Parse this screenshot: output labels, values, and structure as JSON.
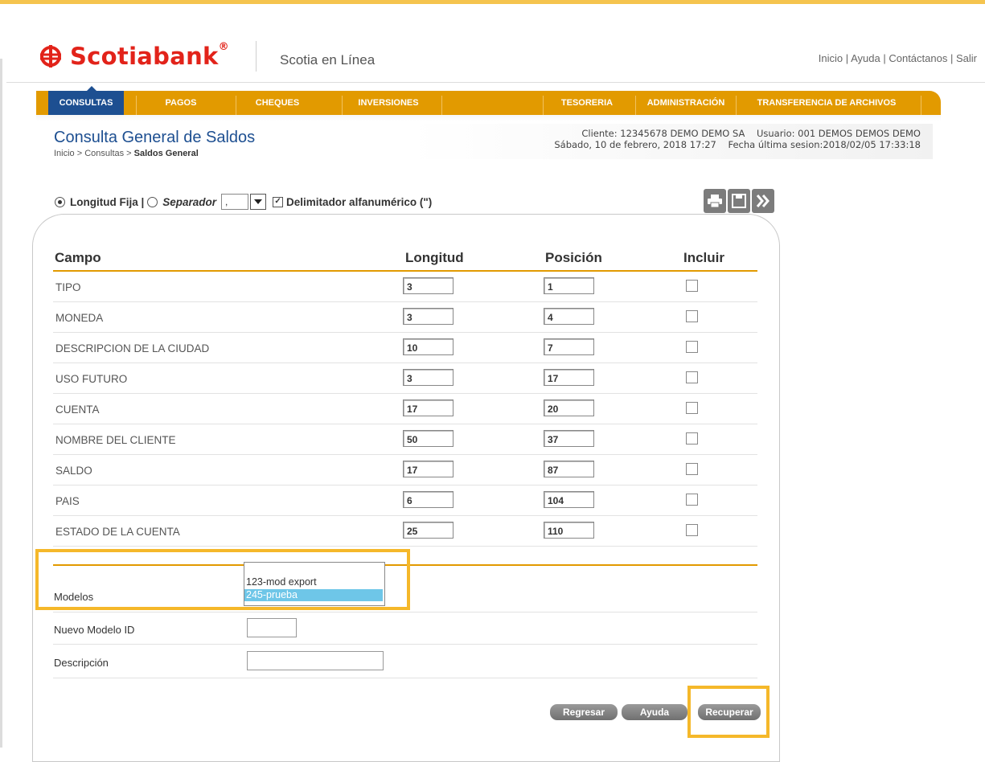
{
  "header": {
    "brand": "Scotiabank",
    "brand_mark": "®",
    "subtitle": "Scotia en Línea",
    "links": [
      "Inicio",
      "Ayuda",
      "Contáctanos",
      "Salir"
    ],
    "link_sep": "|"
  },
  "nav": {
    "items": [
      "CONSULTAS",
      "PAGOS",
      "CHEQUES",
      "INVERSIONES",
      "TESORERIA",
      "ADMINISTRACIÓN",
      "TRANSFERENCIA DE ARCHIVOS"
    ],
    "active": "CONSULTAS"
  },
  "page": {
    "title": "Consulta General de Saldos",
    "breadcrumb_prefix": "Inicio > Consultas > ",
    "breadcrumb_current": "Saldos General",
    "cliente_line": "Cliente: 12345678 DEMO DEMO SA    Usuario: 001 DEMOS DEMOS DEMO",
    "fecha_line": "Sábado, 10 de febrero, 2018 17:27    Fecha última sesion:2018/02/05 17:33:18"
  },
  "options": {
    "fixed_label": "Longitud Fija |",
    "separator_label": "Separador",
    "separator_value": ",",
    "delimiter_label": "Delimitador alfanumérico (\")",
    "fixed_selected": true,
    "delimiter_checked": true
  },
  "table": {
    "headers": {
      "campo": "Campo",
      "longitud": "Longitud",
      "posicion": "Posición",
      "incluir": "Incluir"
    },
    "rows": [
      {
        "campo": "TIPO",
        "longitud": "3",
        "posicion": "1"
      },
      {
        "campo": "MONEDA",
        "longitud": "3",
        "posicion": "4"
      },
      {
        "campo": "DESCRIPCION DE LA CIUDAD",
        "longitud": "10",
        "posicion": "7"
      },
      {
        "campo": "USO FUTURO",
        "longitud": "3",
        "posicion": "17"
      },
      {
        "campo": "CUENTA",
        "longitud": "17",
        "posicion": "20"
      },
      {
        "campo": "NOMBRE DEL CLIENTE",
        "longitud": "50",
        "posicion": "37"
      },
      {
        "campo": "SALDO",
        "longitud": "17",
        "posicion": "87"
      },
      {
        "campo": "PAIS",
        "longitud": "6",
        "posicion": "104"
      },
      {
        "campo": "ESTADO DE LA CUENTA",
        "longitud": "25",
        "posicion": "110"
      }
    ]
  },
  "models": {
    "label": "Modelos",
    "options": [
      "123-mod export",
      "245-prueba"
    ],
    "selected": "245-prueba",
    "new_id_label": "Nuevo Modelo  ID",
    "new_id_value": "",
    "description_label": "Descripción",
    "description_value": ""
  },
  "buttons": {
    "back": "Regresar",
    "help": "Ayuda",
    "retrieve": "Recuperar"
  },
  "colors": {
    "brand_red": "#e2231a",
    "nav_orange": "#e29a00",
    "nav_active": "#1d4f91",
    "highlight": "#f5b82a",
    "list_selected": "#6ec6e8"
  }
}
